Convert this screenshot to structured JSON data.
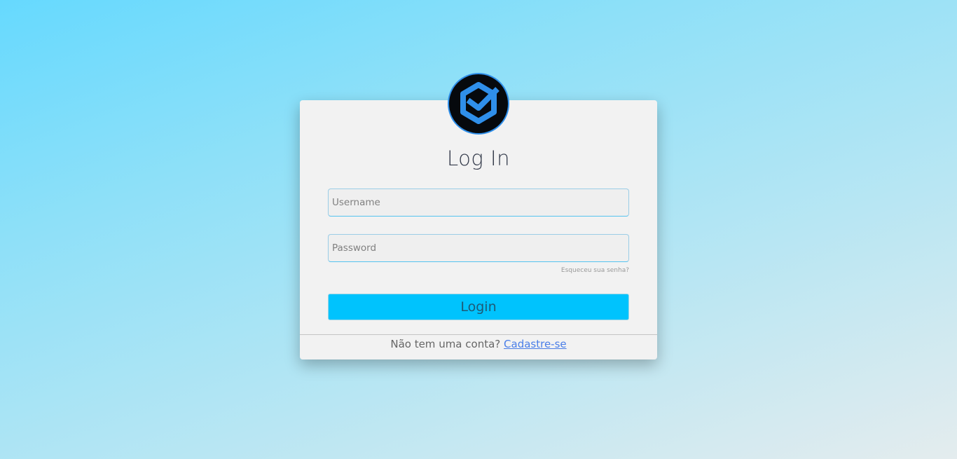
{
  "login": {
    "title": "Log In",
    "username_placeholder": "Username",
    "password_placeholder": "Password",
    "forgot_password": "Esqueceu sua senha?",
    "login_button": "Login",
    "signup_prompt": "Não tem uma conta?",
    "signup_link": "Cadastre-se"
  },
  "icons": {
    "logo": "brand-logo-icon"
  },
  "colors": {
    "button": "#00c3fd",
    "logo_blue": "#2f8fea",
    "link": "#4a7ee8"
  }
}
